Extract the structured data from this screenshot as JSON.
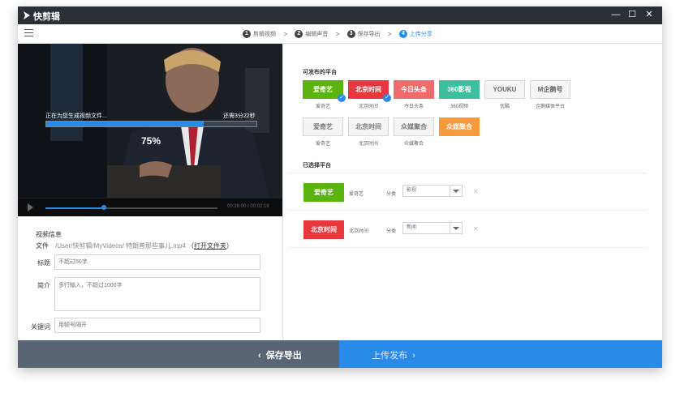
{
  "titlebar": {
    "app_title": "快剪辑",
    "minimize": "—",
    "maximize": "☐",
    "close": "✕"
  },
  "steps": [
    {
      "num": "1",
      "label": "剪辑视频",
      "active": false
    },
    {
      "num": "2",
      "label": "编辑声音",
      "active": false
    },
    {
      "num": "3",
      "label": "保存导出",
      "active": false
    },
    {
      "num": "4",
      "label": "上传分享",
      "active": true
    }
  ],
  "step_separator": ">",
  "video": {
    "status_text": "正在为您生成视频文件...",
    "remaining_text": "还需3分22秒",
    "progress_percent": 75,
    "progress_label": "75%",
    "time_display": "00:26:00 / 00:02:18",
    "seek_fraction": 0.34
  },
  "info": {
    "section_title": "视频信息",
    "file_label": "文件",
    "file_path": "/User/快剪辑/MyVideos/ 特朗普那些事儿.mp4",
    "open_folder_prefix": "（",
    "open_folder": "打开文件夹",
    "open_folder_suffix": "）",
    "title_label": "标题",
    "title_placeholder": "不超过50字",
    "desc_label": "简介",
    "desc_placeholder": "多行输入，不超过1000字",
    "keywords_label": "关键词",
    "keywords_placeholder": "用顿号隔开"
  },
  "platforms": {
    "section_title": "可发布的平台",
    "items": [
      {
        "logo": "爱奇艺",
        "name": "爱奇艺",
        "selected": true,
        "bg": "#5bb30e",
        "fg": "#ffffff"
      },
      {
        "logo": "北京时间",
        "name": "北京时间",
        "selected": true,
        "bg": "#e8383d",
        "fg": "#ffffff"
      },
      {
        "logo": "今日头条",
        "name": "今日头条",
        "selected": false,
        "bg": "#f06b6b",
        "fg": "#ffffff"
      },
      {
        "logo": "360影视",
        "name": "360视频",
        "selected": false,
        "bg": "#3dbf9e",
        "fg": "#ffffff"
      },
      {
        "logo": "YOUKU",
        "name": "优酷",
        "selected": false,
        "bg": "#f4f4f4",
        "fg": "#666666"
      },
      {
        "logo": "M企鹅号",
        "name": "企鹅媒体平台",
        "selected": false,
        "bg": "#f4f4f4",
        "fg": "#666666"
      },
      {
        "logo": "爱奇艺",
        "name": "爱奇艺",
        "selected": false,
        "bg": "#f4f4f4",
        "fg": "#777777"
      },
      {
        "logo": "北京时间",
        "name": "北京时间",
        "selected": false,
        "bg": "#f4f4f4",
        "fg": "#777777"
      },
      {
        "logo": "众媒聚合",
        "name": "众媒聚合",
        "selected": false,
        "bg": "#f4f4f4",
        "fg": "#777777"
      },
      {
        "logo": "众媒聚合",
        "name": "",
        "selected": false,
        "bg": "#f79a3e",
        "fg": "#ffffff"
      }
    ]
  },
  "selected_platforms": {
    "section_title": "已选择平台",
    "rows": [
      {
        "logo": "爱奇艺",
        "name": "爱奇艺",
        "category_label": "分类",
        "category_value": "影视",
        "bg": "#5bb30e",
        "remove": "✕"
      },
      {
        "logo": "北京时间",
        "name": "北京时间",
        "category_label": "分类",
        "category_value": "新闻",
        "bg": "#e8383d",
        "remove": "✕"
      }
    ]
  },
  "footer": {
    "save_label": "保存导出",
    "upload_label": "上传发布"
  },
  "colors": {
    "accent": "#2a8ae8",
    "titlebar": "#2b3036",
    "save_button": "#5a6573"
  }
}
